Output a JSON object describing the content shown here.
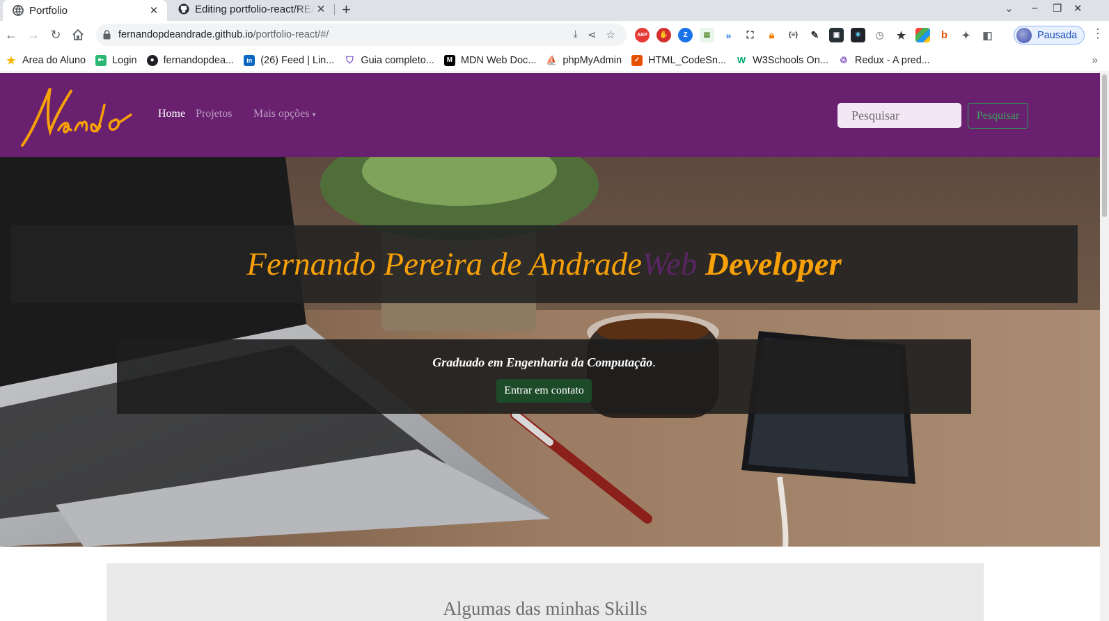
{
  "browser": {
    "tabs": [
      {
        "title": "Portfolio",
        "active": true
      },
      {
        "title": "Editing portfolio-react/README",
        "active": false
      }
    ],
    "url_host": "fernandopdeandrade.github.io",
    "url_path": "/portfolio-react/#/",
    "profile_label": "Pausada",
    "bookmarks": [
      {
        "label": "Area do Aluno",
        "icon": "star-icon",
        "color": "#f4b400"
      },
      {
        "label": "Login",
        "icon": "login-icon",
        "color": "#2bb673"
      },
      {
        "label": "fernandopdea...",
        "icon": "github-icon",
        "color": "#202124"
      },
      {
        "label": "(26) Feed | Lin...",
        "icon": "linkedin-icon",
        "color": "#0a66c2"
      },
      {
        "label": "Guia completo...",
        "icon": "shield-icon",
        "color": "#7e57c2"
      },
      {
        "label": "MDN Web Doc...",
        "icon": "mdn-icon",
        "color": "#000000"
      },
      {
        "label": "phpMyAdmin",
        "icon": "phpmyadmin-icon",
        "color": "#f29111"
      },
      {
        "label": "HTML_CodeSn...",
        "icon": "checkbox-icon",
        "color": "#e65100"
      },
      {
        "label": "W3Schools On...",
        "icon": "w3schools-icon",
        "color": "#04aa6d"
      },
      {
        "label": "Redux - A pred...",
        "icon": "redux-icon",
        "color": "#764abc"
      }
    ]
  },
  "site": {
    "logo_text": "Nando",
    "nav": {
      "home": "Home",
      "projects": "Projetos",
      "more": "Mais opções"
    },
    "search": {
      "placeholder": "Pesquisar",
      "button": "Pesquisar"
    },
    "hero": {
      "name": "Fernando Pereira de Andrade",
      "web": "Web",
      "role": "Developer",
      "tagline": "Graduado em Engenharia da Computação",
      "tagline_end": ".",
      "cta": "Entrar em contato"
    },
    "skills_title": "Algumas das minhas Skills"
  },
  "colors": {
    "navbar": "#68206f",
    "accent_orange": "#f7a008",
    "search_green": "#3aa45a",
    "cta_green": "#1d4b2a"
  }
}
